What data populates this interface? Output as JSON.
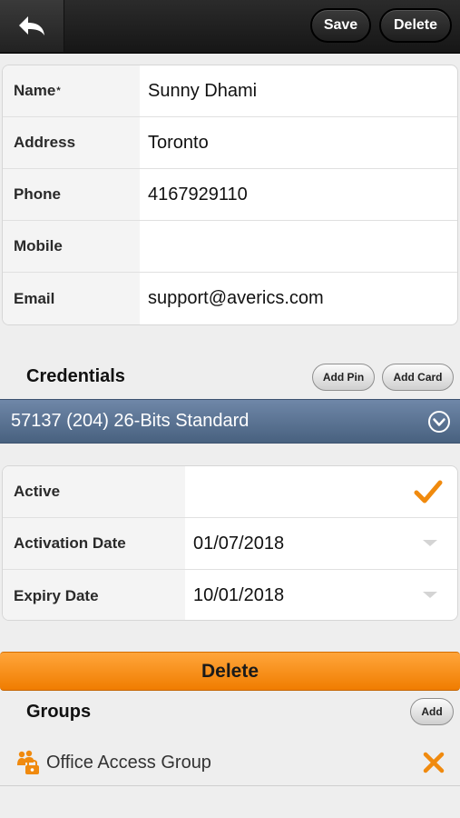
{
  "toolbar": {
    "save_label": "Save",
    "delete_label": "Delete"
  },
  "contact": [
    {
      "label": "Name",
      "required_mark": "*",
      "value": "Sunny  Dhami"
    },
    {
      "label": "Address",
      "value": "Toronto"
    },
    {
      "label": "Phone",
      "value": "4167929110"
    },
    {
      "label": "Mobile",
      "value": ""
    },
    {
      "label": "Email",
      "value": "support@averics.com"
    }
  ],
  "credentials": {
    "title": "Credentials",
    "add_pin_label": "Add Pin",
    "add_card_label": "Add Card",
    "selected_credential": "57137 (204) 26-Bits Standard",
    "active_label": "Active",
    "active_checked": true,
    "activation_date_label": "Activation Date",
    "activation_date": "01/07/2018",
    "expiry_date_label": "Expiry Date",
    "expiry_date": "10/01/2018",
    "delete_label": "Delete"
  },
  "groups": {
    "title": "Groups",
    "add_label": "Add",
    "items": [
      {
        "name": "Office Access Group"
      }
    ]
  },
  "colors": {
    "accent_orange": "#f08a0e",
    "credential_bar": "#5b7393"
  }
}
